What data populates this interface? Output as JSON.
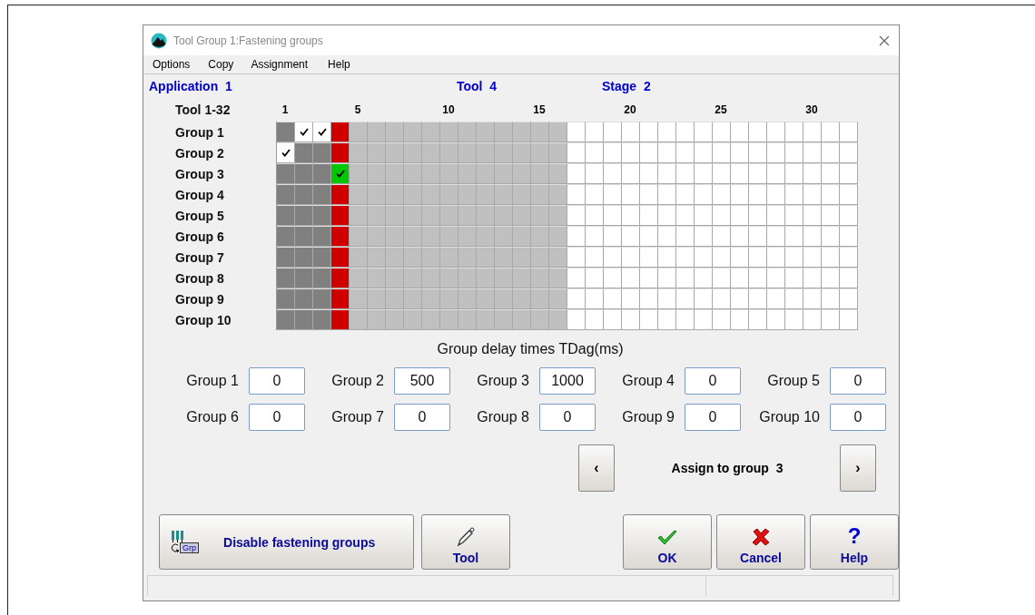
{
  "window": {
    "title": "Tool Group 1:Fastening groups"
  },
  "menu": [
    "Options",
    "Copy",
    "Assignment",
    "Help"
  ],
  "header": {
    "application": "Application  1",
    "tool": "Tool  4",
    "stage": "Stage  2"
  },
  "grid": {
    "corner": "Tool 1-32",
    "columns": [
      {
        "kind": "other",
        "label": "1"
      },
      {
        "kind": "other"
      },
      {
        "kind": "other"
      },
      {
        "kind": "current"
      },
      {
        "kind": "disabled",
        "label": "5"
      },
      {
        "kind": "disabled"
      },
      {
        "kind": "disabled"
      },
      {
        "kind": "disabled"
      },
      {
        "kind": "disabled"
      },
      {
        "kind": "disabled",
        "label": "10"
      },
      {
        "kind": "disabled"
      },
      {
        "kind": "disabled"
      },
      {
        "kind": "disabled"
      },
      {
        "kind": "disabled"
      },
      {
        "kind": "disabled",
        "label": "15"
      },
      {
        "kind": "disabled"
      },
      {
        "kind": "free"
      },
      {
        "kind": "free"
      },
      {
        "kind": "free"
      },
      {
        "kind": "free",
        "label": "20"
      },
      {
        "kind": "free"
      },
      {
        "kind": "free"
      },
      {
        "kind": "free"
      },
      {
        "kind": "free"
      },
      {
        "kind": "free",
        "label": "25"
      },
      {
        "kind": "free"
      },
      {
        "kind": "free"
      },
      {
        "kind": "free"
      },
      {
        "kind": "free"
      },
      {
        "kind": "free",
        "label": "30"
      },
      {
        "kind": "free"
      },
      {
        "kind": "free"
      }
    ],
    "rows": [
      {
        "label": "Group 1",
        "checked": [
          false,
          true,
          true,
          false,
          false,
          false,
          false,
          false,
          false,
          false,
          false,
          false,
          false,
          false,
          false,
          false,
          false,
          false,
          false,
          false,
          false,
          false,
          false,
          false,
          false,
          false,
          false,
          false,
          false,
          false,
          false,
          false
        ]
      },
      {
        "label": "Group 2",
        "checked": [
          true,
          false,
          false,
          false,
          false,
          false,
          false,
          false,
          false,
          false,
          false,
          false,
          false,
          false,
          false,
          false,
          false,
          false,
          false,
          false,
          false,
          false,
          false,
          false,
          false,
          false,
          false,
          false,
          false,
          false,
          false,
          false
        ]
      },
      {
        "label": "Group 3",
        "checked": [
          false,
          false,
          false,
          true,
          false,
          false,
          false,
          false,
          false,
          false,
          false,
          false,
          false,
          false,
          false,
          false,
          false,
          false,
          false,
          false,
          false,
          false,
          false,
          false,
          false,
          false,
          false,
          false,
          false,
          false,
          false,
          false
        ]
      },
      {
        "label": "Group 4",
        "checked": [
          false,
          false,
          false,
          false,
          false,
          false,
          false,
          false,
          false,
          false,
          false,
          false,
          false,
          false,
          false,
          false,
          false,
          false,
          false,
          false,
          false,
          false,
          false,
          false,
          false,
          false,
          false,
          false,
          false,
          false,
          false,
          false
        ]
      },
      {
        "label": "Group 5",
        "checked": [
          false,
          false,
          false,
          false,
          false,
          false,
          false,
          false,
          false,
          false,
          false,
          false,
          false,
          false,
          false,
          false,
          false,
          false,
          false,
          false,
          false,
          false,
          false,
          false,
          false,
          false,
          false,
          false,
          false,
          false,
          false,
          false
        ]
      },
      {
        "label": "Group 6",
        "checked": [
          false,
          false,
          false,
          false,
          false,
          false,
          false,
          false,
          false,
          false,
          false,
          false,
          false,
          false,
          false,
          false,
          false,
          false,
          false,
          false,
          false,
          false,
          false,
          false,
          false,
          false,
          false,
          false,
          false,
          false,
          false,
          false
        ]
      },
      {
        "label": "Group 7",
        "checked": [
          false,
          false,
          false,
          false,
          false,
          false,
          false,
          false,
          false,
          false,
          false,
          false,
          false,
          false,
          false,
          false,
          false,
          false,
          false,
          false,
          false,
          false,
          false,
          false,
          false,
          false,
          false,
          false,
          false,
          false,
          false,
          false
        ]
      },
      {
        "label": "Group 8",
        "checked": [
          false,
          false,
          false,
          false,
          false,
          false,
          false,
          false,
          false,
          false,
          false,
          false,
          false,
          false,
          false,
          false,
          false,
          false,
          false,
          false,
          false,
          false,
          false,
          false,
          false,
          false,
          false,
          false,
          false,
          false,
          false,
          false
        ]
      },
      {
        "label": "Group 9",
        "checked": [
          false,
          false,
          false,
          false,
          false,
          false,
          false,
          false,
          false,
          false,
          false,
          false,
          false,
          false,
          false,
          false,
          false,
          false,
          false,
          false,
          false,
          false,
          false,
          false,
          false,
          false,
          false,
          false,
          false,
          false,
          false,
          false
        ]
      },
      {
        "label": "Group 10",
        "checked": [
          false,
          false,
          false,
          false,
          false,
          false,
          false,
          false,
          false,
          false,
          false,
          false,
          false,
          false,
          false,
          false,
          false,
          false,
          false,
          false,
          false,
          false,
          false,
          false,
          false,
          false,
          false,
          false,
          false,
          false,
          false,
          false
        ]
      }
    ]
  },
  "delays": {
    "title": "Group delay times TDag(ms)",
    "fields": [
      {
        "label": "Group 1",
        "value": "0"
      },
      {
        "label": "Group 2",
        "value": "500"
      },
      {
        "label": "Group 3",
        "value": "1000"
      },
      {
        "label": "Group 4",
        "value": "0"
      },
      {
        "label": "Group 5",
        "value": "0"
      },
      {
        "label": "Group 6",
        "value": "0"
      },
      {
        "label": "Group 7",
        "value": "0"
      },
      {
        "label": "Group 8",
        "value": "0"
      },
      {
        "label": "Group 9",
        "value": "0"
      },
      {
        "label": "Group 10",
        "value": "0"
      }
    ]
  },
  "assign": {
    "previous": "‹",
    "label": "Assign to group  3",
    "next": "›"
  },
  "buttons": [
    {
      "kind": "disable",
      "label": "Disable fastening groups",
      "icon_text": "Grp"
    },
    {
      "kind": "tool",
      "label": "Tool"
    },
    {
      "kind": "ok",
      "label": "OK"
    },
    {
      "kind": "cancel",
      "label": "Cancel"
    },
    {
      "kind": "help",
      "label": "Help",
      "icon_text": "?"
    }
  ]
}
